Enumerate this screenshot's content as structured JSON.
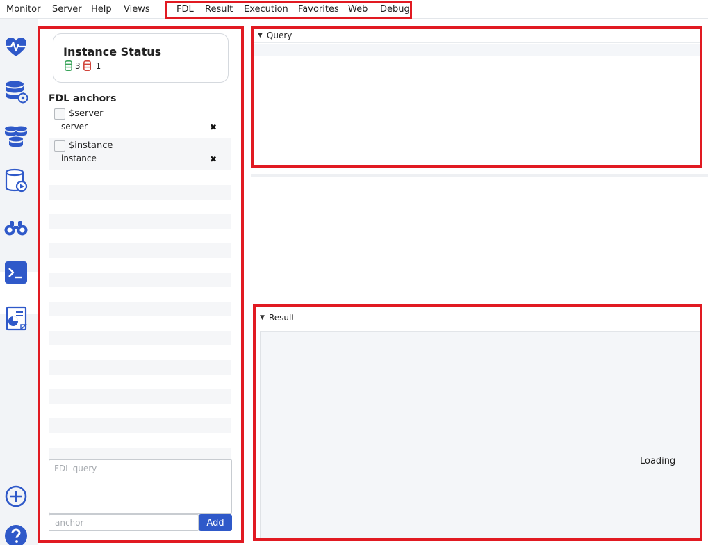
{
  "menu": {
    "items": [
      "Monitor",
      "Server",
      "Help",
      "Views"
    ],
    "fdl_items": [
      "FDL",
      "Result",
      "Execution",
      "Favorites",
      "Web",
      "Debug"
    ]
  },
  "sidebar": {
    "icons": [
      "heart-monitor-icon",
      "database-settings-icon",
      "database-sync-icon",
      "database-play-icon",
      "binoculars-icon",
      "terminal-icon",
      "report-chart-icon"
    ],
    "bottom_icons": [
      "add-circle-icon",
      "help-icon"
    ],
    "active": "terminal-icon",
    "accent": "#2f59c9"
  },
  "status": {
    "title": "Instance Status",
    "ok_count": "3",
    "error_count": "1",
    "ok_color": "#3aa35a",
    "error_color": "#d1453b"
  },
  "anchors": {
    "title": "FDL anchors",
    "items": [
      {
        "name": "$server",
        "value": "server"
      },
      {
        "name": "$instance",
        "value": "instance"
      }
    ],
    "remove_symbol": "✖"
  },
  "query_input": {
    "placeholder": "FDL query"
  },
  "anchor_input": {
    "placeholder": "anchor"
  },
  "add_label": "Add",
  "query_panel": {
    "title": "Query"
  },
  "result_panel": {
    "title": "Result",
    "status": "Loading"
  },
  "highlight_color": "#e11a22"
}
